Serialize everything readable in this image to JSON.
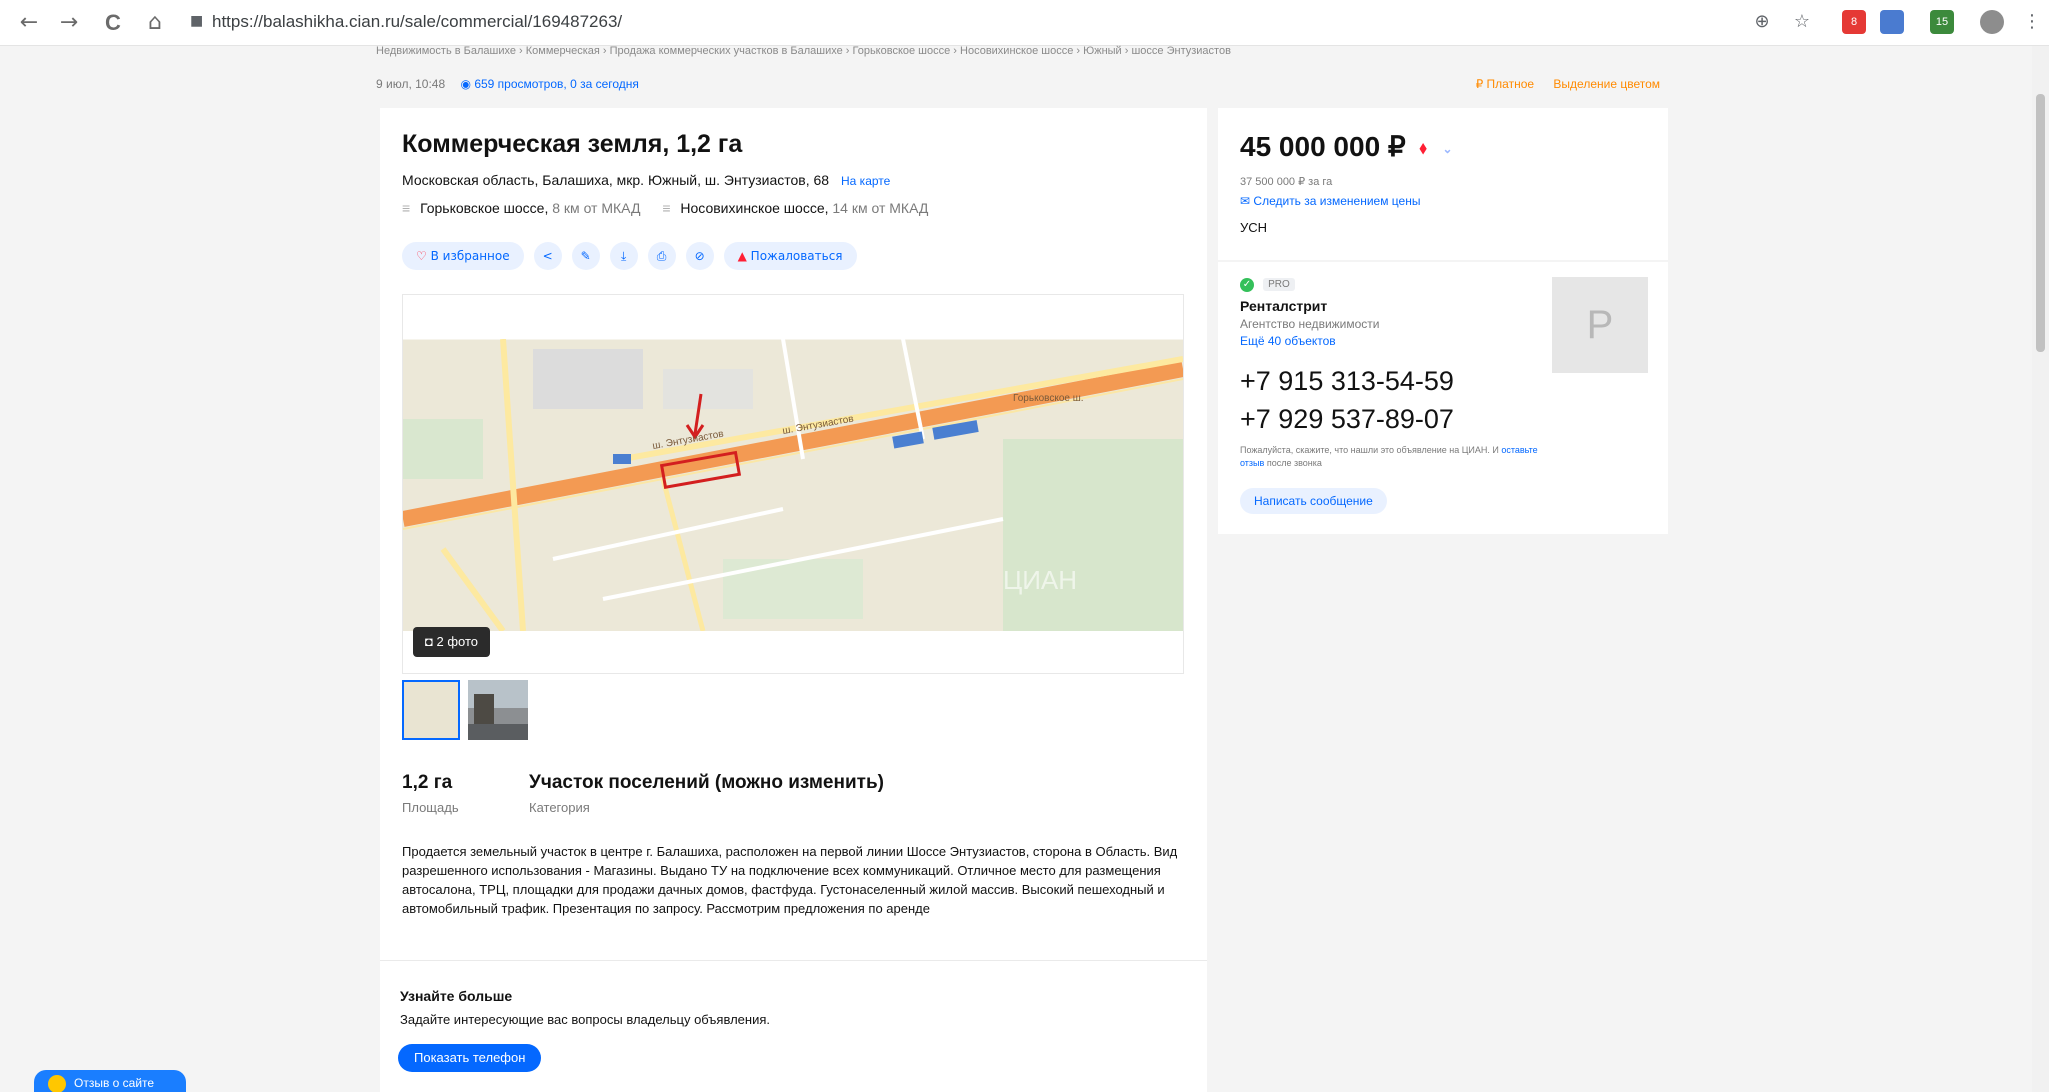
{
  "browser": {
    "back_icon": "←",
    "forward_icon": "→",
    "reload_icon": "C",
    "home_icon": "⌂",
    "lock_icon": "🔒",
    "url": "https://balashikha.cian.ru/sale/commercial/169487263/",
    "zoom_icon": "⊕",
    "star_icon": "☆",
    "ext_badge_1": "8",
    "ext_badge_2": "15",
    "menu_icon": "⋮"
  },
  "breadcrumb": "Недвижимость в Балашихе  ›  Коммерческая  ›  Продажа коммерческих участков в Балашихе  ›  Горьковское шоссе  ›  Носовихинское шоссе  ›  Южный  ›  шоссе Энтузиастов",
  "meta": {
    "date": "9 июл, 10:48",
    "views": "659 просмотров, 0 за сегодня"
  },
  "promo": {
    "paid": "₽ Платное",
    "highlight": "Выделение цветом"
  },
  "listing": {
    "title": "Коммерческая земля, 1,2 га",
    "address": "Московская область, Балашиха, мкр. Южный, ш. Энтузиастов, 68",
    "map_link": "На карте",
    "highway1_name": "Горьковское шоссе,",
    "highway1_dist": "8 км от МКАД",
    "highway2_name": "Носовихинское шоссе,",
    "highway2_dist": "14 км от МКАД"
  },
  "actions": {
    "favorite": "В избранное",
    "share_icon": "<",
    "edit_icon": "✎",
    "download_icon": "⤓",
    "print_icon": "⎙",
    "hide_icon": "⊘",
    "complain": "Пожаловаться"
  },
  "gallery": {
    "photo_count": "2 фото",
    "map_labels": {
      "highway_top": "Горьковское ш.",
      "street_main": "ш. Энтузиастов",
      "street_main2": "ш. Энтузиастов",
      "watermark": "ЦИАН"
    }
  },
  "facts": [
    {
      "value": "1,2 га",
      "label": "Площадь"
    },
    {
      "value": "Участок поселений (можно изменить)",
      "label": "Категория"
    }
  ],
  "description": "Продается земельный участок в центре г. Балашиха, расположен на первой линии Шоссе Энтузиастов, сторона в Область. Вид разрешенного использования - Магазины. Выдано ТУ на подключение всех коммуникаций. Отличное место для размещения автосалона, ТРЦ, площадки для продажи дачных домов, фастфуда. Густонаселенный жилой массив. Высокий пешеходный и автомобильный трафик. Презентация по запросу. Рассмотрим предложения по аренде",
  "learn_more": {
    "title": "Узнайте больше",
    "text": "Задайте интересующие вас вопросы владельцу объявления.",
    "button": "Показать телефон"
  },
  "price_block": {
    "price": "45 000 000 ₽",
    "trend_icon": "⬧",
    "chevron_icon": "⌄",
    "per_area": "37 500 000 ₽ за га",
    "follow": "Следить за изменением цены",
    "tax": "УСН"
  },
  "agent": {
    "pro": "PRO",
    "name": "Ренталстрит",
    "type": "Агентство недвижимости",
    "more": "Ещё 40 объектов",
    "logo_letter": "Р",
    "phone1": "+7 915 313-54-59",
    "phone2": "+7 929 537-89-07",
    "note_prefix": "Пожалуйста, скажите, что нашли это объявление на ЦИАН. И",
    "note_link": "оставьте отзыв",
    "note_suffix": "после звонка",
    "write": "Написать сообщение"
  },
  "feedback": "Отзыв о сайте",
  "colors": {
    "accent": "#0468ff",
    "danger": "#ff1f34",
    "promo": "#ff8a00",
    "map_road": "#f39a53"
  }
}
